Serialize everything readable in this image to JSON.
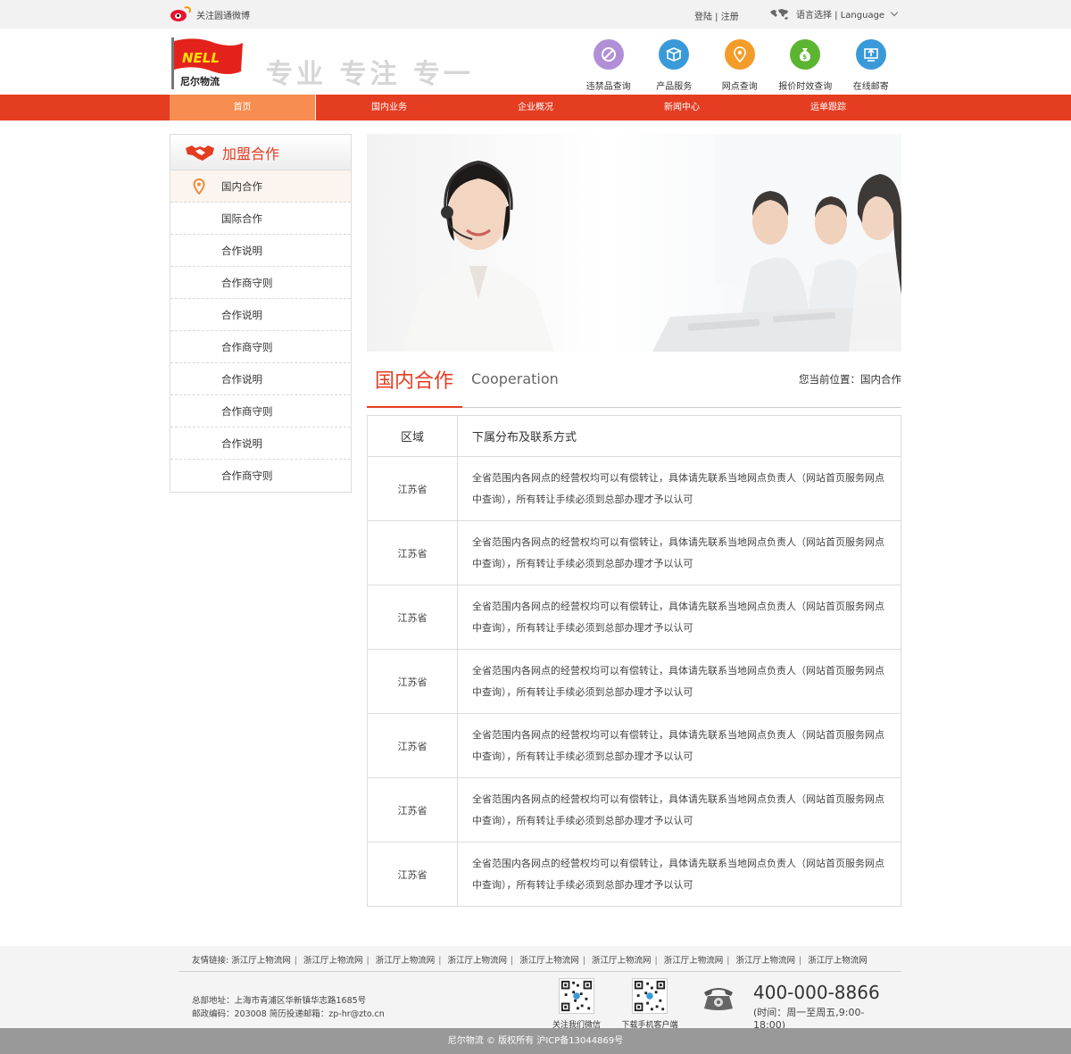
{
  "topbar": {
    "weibo_text": "关注圆通微博",
    "login_text": "登陆 | 注册",
    "language_text": "语言选择 | Language"
  },
  "header": {
    "logo_text": "NELL",
    "logo_subtext": "尼尔物流",
    "slogan": "专业 专注 专一",
    "quick_links": [
      {
        "label": "违禁品查询",
        "color": "#b08fd6"
      },
      {
        "label": "产品服务",
        "color": "#3a9ad9"
      },
      {
        "label": "网点查询",
        "color": "#f39c29"
      },
      {
        "label": "报价时效查询",
        "color": "#5cb531"
      },
      {
        "label": "在线邮寄",
        "color": "#3a9ad9"
      }
    ]
  },
  "nav": {
    "tabs": [
      "首页",
      "国内业务",
      "企业概况",
      "新闻中心",
      "运单跟踪"
    ]
  },
  "sidebar": {
    "title": "加盟合作",
    "items": [
      "国内合作",
      "国际合作",
      "合作说明",
      "合作商守则",
      "合作说明",
      "合作商守则",
      "合作说明",
      "合作商守则",
      "合作说明",
      "合作商守则"
    ]
  },
  "content": {
    "title_cn": "国内合作",
    "title_en": "Cooperation",
    "breadcrumb": "您当前位置：国内合作",
    "table": {
      "headers": [
        "区域",
        "下属分布及联系方式"
      ],
      "rows": [
        {
          "region": "江苏省",
          "desc": "全省范围内各网点的经营权均可以有偿转让，具体请先联系当地网点负责人（网站首页服务网点中查询），所有转让手续必须到总部办理才予以认可"
        },
        {
          "region": "江苏省",
          "desc": "全省范围内各网点的经营权均可以有偿转让，具体请先联系当地网点负责人（网站首页服务网点中查询），所有转让手续必须到总部办理才予以认可"
        },
        {
          "region": "江苏省",
          "desc": "全省范围内各网点的经营权均可以有偿转让，具体请先联系当地网点负责人（网站首页服务网点中查询），所有转让手续必须到总部办理才予以认可"
        },
        {
          "region": "江苏省",
          "desc": "全省范围内各网点的经营权均可以有偿转让，具体请先联系当地网点负责人（网站首页服务网点中查询），所有转让手续必须到总部办理才予以认可"
        },
        {
          "region": "江苏省",
          "desc": "全省范围内各网点的经营权均可以有偿转让，具体请先联系当地网点负责人（网站首页服务网点中查询），所有转让手续必须到总部办理才予以认可"
        },
        {
          "region": "江苏省",
          "desc": "全省范围内各网点的经营权均可以有偿转让，具体请先联系当地网点负责人（网站首页服务网点中查询），所有转让手续必须到总部办理才予以认可"
        },
        {
          "region": "江苏省",
          "desc": "全省范围内各网点的经营权均可以有偿转让，具体请先联系当地网点负责人（网站首页服务网点中查询），所有转让手续必须到总部办理才予以认可"
        }
      ]
    }
  },
  "footer": {
    "links_label": "友情链接:",
    "links": [
      "浙江厅上物流网",
      "浙江厅上物流网",
      "浙江厅上物流网",
      "浙江厅上物流网",
      "浙江厅上物流网",
      "浙江厅上物流网",
      "浙江厅上物流网",
      "浙江厅上物流网",
      "浙江厅上物流网"
    ],
    "address": "总部地址：上海市青浦区华新镇华志路1685号",
    "postal": "邮政编码：203008 简历投递邮箱：zp-hr@zto.cn",
    "qr_wechat": "关注我们微信",
    "qr_app": "下载手机客户端",
    "hotline": "400-000-8866",
    "hours": "(时间：周一至周五,9:00-18:00)",
    "copyright": "尼尔物流 © 版权所有 沪ICP备13044869号"
  },
  "colors": {
    "brand_red": "#e43d21",
    "nav_active": "#f78d50"
  }
}
